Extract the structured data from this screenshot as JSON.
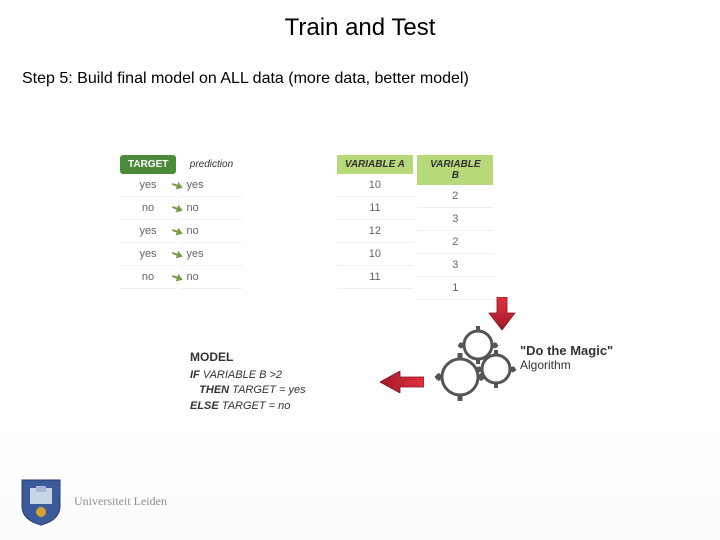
{
  "title": "Train and Test",
  "step": "Step 5: Build final model on ALL data (more data, better model)",
  "target": {
    "header": "TARGET",
    "rows": [
      "yes",
      "no",
      "yes",
      "yes",
      "no"
    ]
  },
  "prediction": {
    "header": "prediction",
    "rows": [
      "yes",
      "no",
      "no",
      "yes",
      "no"
    ]
  },
  "varA": {
    "header": "VARIABLE A",
    "rows": [
      "10",
      "11",
      "12",
      "10",
      "11"
    ]
  },
  "varB": {
    "header": "VARIABLE B",
    "rows": [
      "2",
      "3",
      "2",
      "3",
      "1"
    ]
  },
  "magic": {
    "line1": "\"Do the Magic\"",
    "line2": "Algorithm"
  },
  "model": {
    "title": "MODEL",
    "if": "IF",
    "cond": " VARIABLE B >2",
    "then": "THEN",
    "thenBody": " TARGET = yes",
    "else": "ELSE",
    "elseBody": " TARGET = no"
  },
  "university": "Universiteit Leiden"
}
